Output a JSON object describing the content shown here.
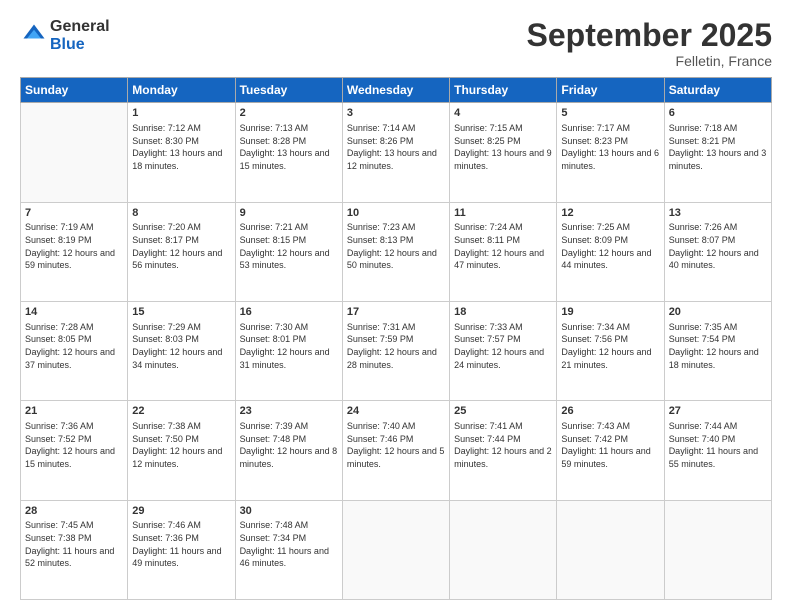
{
  "logo": {
    "general": "General",
    "blue": "Blue"
  },
  "header": {
    "month": "September 2025",
    "location": "Felletin, France"
  },
  "days_of_week": [
    "Sunday",
    "Monday",
    "Tuesday",
    "Wednesday",
    "Thursday",
    "Friday",
    "Saturday"
  ],
  "weeks": [
    [
      {
        "day": "",
        "sunrise": "",
        "sunset": "",
        "daylight": ""
      },
      {
        "day": "1",
        "sunrise": "Sunrise: 7:12 AM",
        "sunset": "Sunset: 8:30 PM",
        "daylight": "Daylight: 13 hours and 18 minutes."
      },
      {
        "day": "2",
        "sunrise": "Sunrise: 7:13 AM",
        "sunset": "Sunset: 8:28 PM",
        "daylight": "Daylight: 13 hours and 15 minutes."
      },
      {
        "day": "3",
        "sunrise": "Sunrise: 7:14 AM",
        "sunset": "Sunset: 8:26 PM",
        "daylight": "Daylight: 13 hours and 12 minutes."
      },
      {
        "day": "4",
        "sunrise": "Sunrise: 7:15 AM",
        "sunset": "Sunset: 8:25 PM",
        "daylight": "Daylight: 13 hours and 9 minutes."
      },
      {
        "day": "5",
        "sunrise": "Sunrise: 7:17 AM",
        "sunset": "Sunset: 8:23 PM",
        "daylight": "Daylight: 13 hours and 6 minutes."
      },
      {
        "day": "6",
        "sunrise": "Sunrise: 7:18 AM",
        "sunset": "Sunset: 8:21 PM",
        "daylight": "Daylight: 13 hours and 3 minutes."
      }
    ],
    [
      {
        "day": "7",
        "sunrise": "Sunrise: 7:19 AM",
        "sunset": "Sunset: 8:19 PM",
        "daylight": "Daylight: 12 hours and 59 minutes."
      },
      {
        "day": "8",
        "sunrise": "Sunrise: 7:20 AM",
        "sunset": "Sunset: 8:17 PM",
        "daylight": "Daylight: 12 hours and 56 minutes."
      },
      {
        "day": "9",
        "sunrise": "Sunrise: 7:21 AM",
        "sunset": "Sunset: 8:15 PM",
        "daylight": "Daylight: 12 hours and 53 minutes."
      },
      {
        "day": "10",
        "sunrise": "Sunrise: 7:23 AM",
        "sunset": "Sunset: 8:13 PM",
        "daylight": "Daylight: 12 hours and 50 minutes."
      },
      {
        "day": "11",
        "sunrise": "Sunrise: 7:24 AM",
        "sunset": "Sunset: 8:11 PM",
        "daylight": "Daylight: 12 hours and 47 minutes."
      },
      {
        "day": "12",
        "sunrise": "Sunrise: 7:25 AM",
        "sunset": "Sunset: 8:09 PM",
        "daylight": "Daylight: 12 hours and 44 minutes."
      },
      {
        "day": "13",
        "sunrise": "Sunrise: 7:26 AM",
        "sunset": "Sunset: 8:07 PM",
        "daylight": "Daylight: 12 hours and 40 minutes."
      }
    ],
    [
      {
        "day": "14",
        "sunrise": "Sunrise: 7:28 AM",
        "sunset": "Sunset: 8:05 PM",
        "daylight": "Daylight: 12 hours and 37 minutes."
      },
      {
        "day": "15",
        "sunrise": "Sunrise: 7:29 AM",
        "sunset": "Sunset: 8:03 PM",
        "daylight": "Daylight: 12 hours and 34 minutes."
      },
      {
        "day": "16",
        "sunrise": "Sunrise: 7:30 AM",
        "sunset": "Sunset: 8:01 PM",
        "daylight": "Daylight: 12 hours and 31 minutes."
      },
      {
        "day": "17",
        "sunrise": "Sunrise: 7:31 AM",
        "sunset": "Sunset: 7:59 PM",
        "daylight": "Daylight: 12 hours and 28 minutes."
      },
      {
        "day": "18",
        "sunrise": "Sunrise: 7:33 AM",
        "sunset": "Sunset: 7:57 PM",
        "daylight": "Daylight: 12 hours and 24 minutes."
      },
      {
        "day": "19",
        "sunrise": "Sunrise: 7:34 AM",
        "sunset": "Sunset: 7:56 PM",
        "daylight": "Daylight: 12 hours and 21 minutes."
      },
      {
        "day": "20",
        "sunrise": "Sunrise: 7:35 AM",
        "sunset": "Sunset: 7:54 PM",
        "daylight": "Daylight: 12 hours and 18 minutes."
      }
    ],
    [
      {
        "day": "21",
        "sunrise": "Sunrise: 7:36 AM",
        "sunset": "Sunset: 7:52 PM",
        "daylight": "Daylight: 12 hours and 15 minutes."
      },
      {
        "day": "22",
        "sunrise": "Sunrise: 7:38 AM",
        "sunset": "Sunset: 7:50 PM",
        "daylight": "Daylight: 12 hours and 12 minutes."
      },
      {
        "day": "23",
        "sunrise": "Sunrise: 7:39 AM",
        "sunset": "Sunset: 7:48 PM",
        "daylight": "Daylight: 12 hours and 8 minutes."
      },
      {
        "day": "24",
        "sunrise": "Sunrise: 7:40 AM",
        "sunset": "Sunset: 7:46 PM",
        "daylight": "Daylight: 12 hours and 5 minutes."
      },
      {
        "day": "25",
        "sunrise": "Sunrise: 7:41 AM",
        "sunset": "Sunset: 7:44 PM",
        "daylight": "Daylight: 12 hours and 2 minutes."
      },
      {
        "day": "26",
        "sunrise": "Sunrise: 7:43 AM",
        "sunset": "Sunset: 7:42 PM",
        "daylight": "Daylight: 11 hours and 59 minutes."
      },
      {
        "day": "27",
        "sunrise": "Sunrise: 7:44 AM",
        "sunset": "Sunset: 7:40 PM",
        "daylight": "Daylight: 11 hours and 55 minutes."
      }
    ],
    [
      {
        "day": "28",
        "sunrise": "Sunrise: 7:45 AM",
        "sunset": "Sunset: 7:38 PM",
        "daylight": "Daylight: 11 hours and 52 minutes."
      },
      {
        "day": "29",
        "sunrise": "Sunrise: 7:46 AM",
        "sunset": "Sunset: 7:36 PM",
        "daylight": "Daylight: 11 hours and 49 minutes."
      },
      {
        "day": "30",
        "sunrise": "Sunrise: 7:48 AM",
        "sunset": "Sunset: 7:34 PM",
        "daylight": "Daylight: 11 hours and 46 minutes."
      },
      {
        "day": "",
        "sunrise": "",
        "sunset": "",
        "daylight": ""
      },
      {
        "day": "",
        "sunrise": "",
        "sunset": "",
        "daylight": ""
      },
      {
        "day": "",
        "sunrise": "",
        "sunset": "",
        "daylight": ""
      },
      {
        "day": "",
        "sunrise": "",
        "sunset": "",
        "daylight": ""
      }
    ]
  ]
}
